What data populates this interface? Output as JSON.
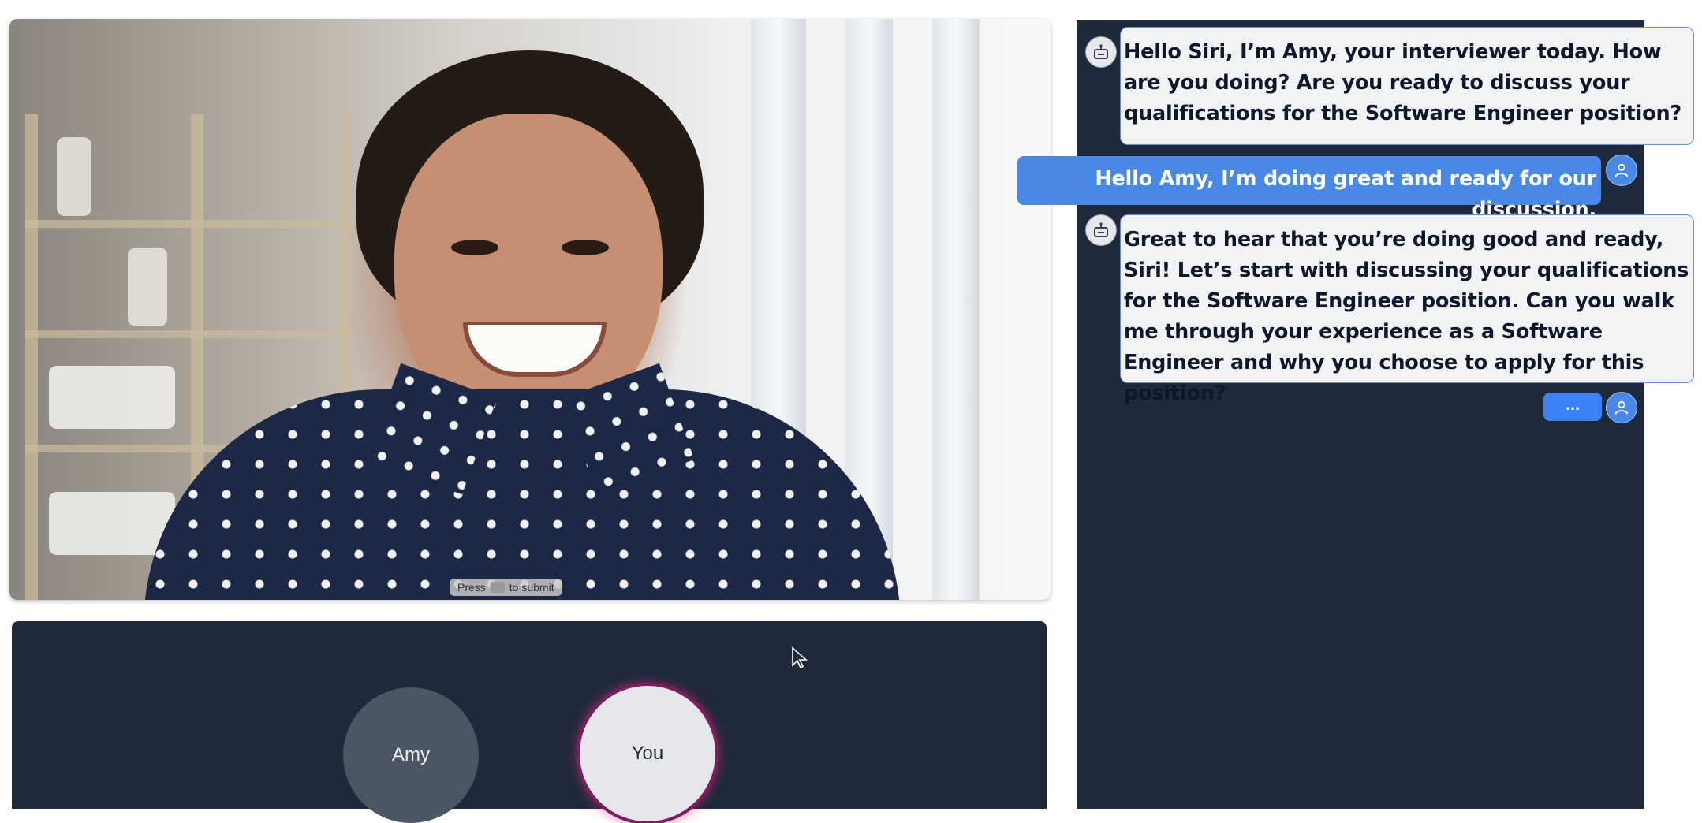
{
  "video": {
    "submit_hint": {
      "prefix": "Press",
      "suffix": "to submit"
    }
  },
  "participants": {
    "interviewer_name": "Amy",
    "self_name": "You"
  },
  "chat": {
    "messages": [
      {
        "role": "interviewer",
        "icon": "robot-icon",
        "text": "Hello Siri, I’m Amy, your interviewer today. How are you doing? Are you ready to discuss your qualifications for the Software Engineer position?"
      },
      {
        "role": "candidate",
        "icon": "user-icon",
        "text": "Hello Amy, I’m doing great and ready for our discussion."
      },
      {
        "role": "interviewer",
        "icon": "robot-icon",
        "text": "Great to hear that you’re doing good and ready, Siri! Let’s start with discussing your qualifications for the Software Engineer position. Can you walk me through your experience as a Software Engineer and why you choose to apply for this position?"
      }
    ],
    "typing_indicator": "..."
  },
  "colors": {
    "panel_bg": "#1e293b",
    "user_bubble": "#4a88e8",
    "ai_bubble": "#f1f3f5",
    "speaking_ring": "#db2777"
  }
}
